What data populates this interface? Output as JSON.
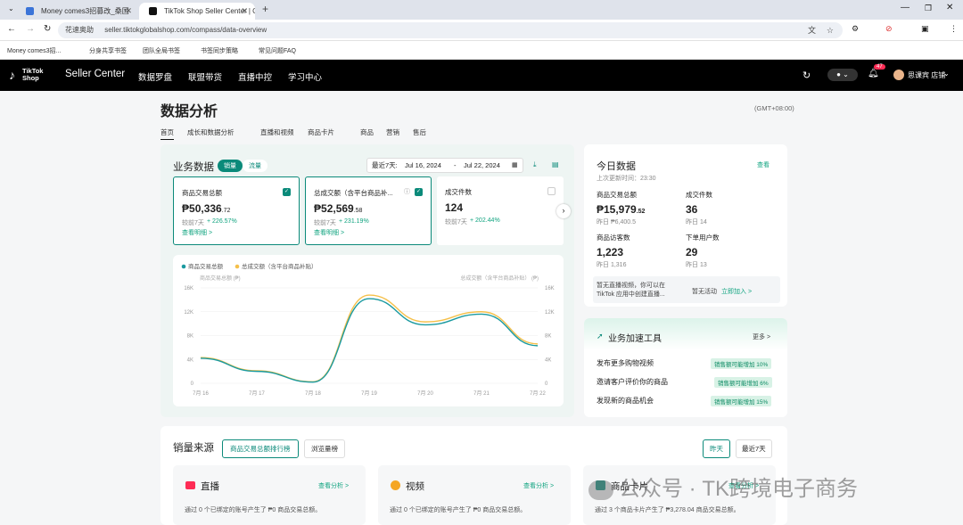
{
  "browser": {
    "tabs": [
      {
        "title": "Money comes3招募改_桑国"
      },
      {
        "title": "TikTok Shop Seller Center | C"
      }
    ],
    "site_label": "花速奥助",
    "url": "seller.tiktokglobalshop.com/compass/data-overview",
    "bookmarks": [
      "Money comes3招...",
      "分身共享书签",
      "团队全局书签",
      "书签同步策略",
      "常见问题FAQ"
    ]
  },
  "nav": {
    "brand": "TikTok Shop",
    "title": "Seller Center",
    "items": [
      "数据罗盘",
      "联盟带货",
      "直播中控",
      "学习中心"
    ],
    "badge": "47",
    "user": "思课宾 店铺"
  },
  "page": {
    "title": "数据分析",
    "timezone": "(GMT+08:00)",
    "tabs": [
      "首页",
      "成长和数据分析",
      "直播和视频",
      "商品卡片",
      "商品",
      "营销",
      "售后"
    ]
  },
  "biz": {
    "title": "业务数据",
    "toggle": [
      "销量",
      "流量"
    ],
    "range_label": "最近7天:",
    "start": "Jul 16, 2024",
    "sep": "-",
    "end": "Jul 22, 2024",
    "metrics": [
      {
        "label": "商品交易总额",
        "prefix": "₱",
        "value": "50,336",
        "dec": ".72",
        "cmp": "较前7天",
        "delta": "+ 226.57%",
        "link": "查看明细 >"
      },
      {
        "label": "总成交额（含平台商品补...",
        "prefix": "₱",
        "value": "52,569",
        "dec": ".58",
        "cmp": "较前7天",
        "delta": "+ 231.19%",
        "link": "查看明细 >"
      },
      {
        "label": "成交件数",
        "prefix": "",
        "value": "124",
        "dec": "",
        "cmp": "较前7天",
        "delta": "+ 202.44%",
        "link": ""
      }
    ]
  },
  "chart_data": {
    "type": "line",
    "legend": [
      "商品交易总额",
      "总成交额（含平台商品补贴）"
    ],
    "ylabel_left": "商品交易总额 (₱)",
    "ylabel_right": "总成交额（含平台商品补贴） (₱)",
    "x": [
      "7月 16",
      "7月 17",
      "7月 18",
      "7月 19",
      "7月 20",
      "7月 21",
      "7月 22"
    ],
    "y_ticks": [
      "0",
      "4K",
      "8K",
      "12K",
      "16K"
    ],
    "ylim": [
      0,
      16000
    ],
    "series": [
      {
        "name": "商品交易总额",
        "color": "#1a9aa0",
        "values": [
          4200,
          2000,
          200,
          14200,
          9800,
          11600,
          6300
        ]
      },
      {
        "name": "总成交额（含平台商品补贴）",
        "color": "#f5c04a",
        "values": [
          4300,
          2100,
          250,
          14800,
          10300,
          12000,
          6600
        ]
      }
    ]
  },
  "today": {
    "title": "今日数据",
    "updated": "上次更新时间：23:30",
    "link": "查看",
    "items": [
      {
        "label": "商品交易总额",
        "value": "₱15,979",
        "dec": ".52",
        "sub": "昨日 ₱6,400.5"
      },
      {
        "label": "成交件数",
        "value": "36",
        "dec": "",
        "sub": "昨日 14"
      },
      {
        "label": "商品访客数",
        "value": "1,223",
        "dec": "",
        "sub": "昨日 1,316"
      },
      {
        "label": "下单用户数",
        "value": "29",
        "dec": "",
        "sub": "昨日 13"
      }
    ],
    "live_note": "暂无直播视频，你可以在 TikTok 应用中创建直播...",
    "live_link_pre": "暂无活动",
    "live_link": "立即加入 >"
  },
  "tools": {
    "title": "业务加速工具",
    "more": "更多 >",
    "rows": [
      {
        "label": "发布更多购物视频",
        "pill": "销售额可能增加 10%"
      },
      {
        "label": "邀请客户评价你的商品",
        "pill": "销售额可能增加 6%"
      },
      {
        "label": "发现新的商品机会",
        "pill": "销售额可能增加 15%"
      }
    ]
  },
  "sales": {
    "title": "销量来源",
    "tabs": [
      "商品交易总额排行榜",
      "浏览量榜"
    ],
    "ranges": [
      "昨天",
      "最近7天"
    ],
    "cards": [
      {
        "title": "直播",
        "link": "查看分析 >",
        "desc": "通过 0 个已绑定的账号产生了 ₱0 商品交易总额。"
      },
      {
        "title": "视频",
        "link": "查看分析 >",
        "desc": "通过 0 个已绑定的账号产生了 ₱0 商品交易总额。"
      },
      {
        "title": "商品卡片",
        "link": "查看分析 >",
        "desc": "通过 3 个商品卡片产生了 ₱3,278.04 商品交易总额。"
      }
    ]
  },
  "watermark": "公众号 · TK跨境电子商务"
}
